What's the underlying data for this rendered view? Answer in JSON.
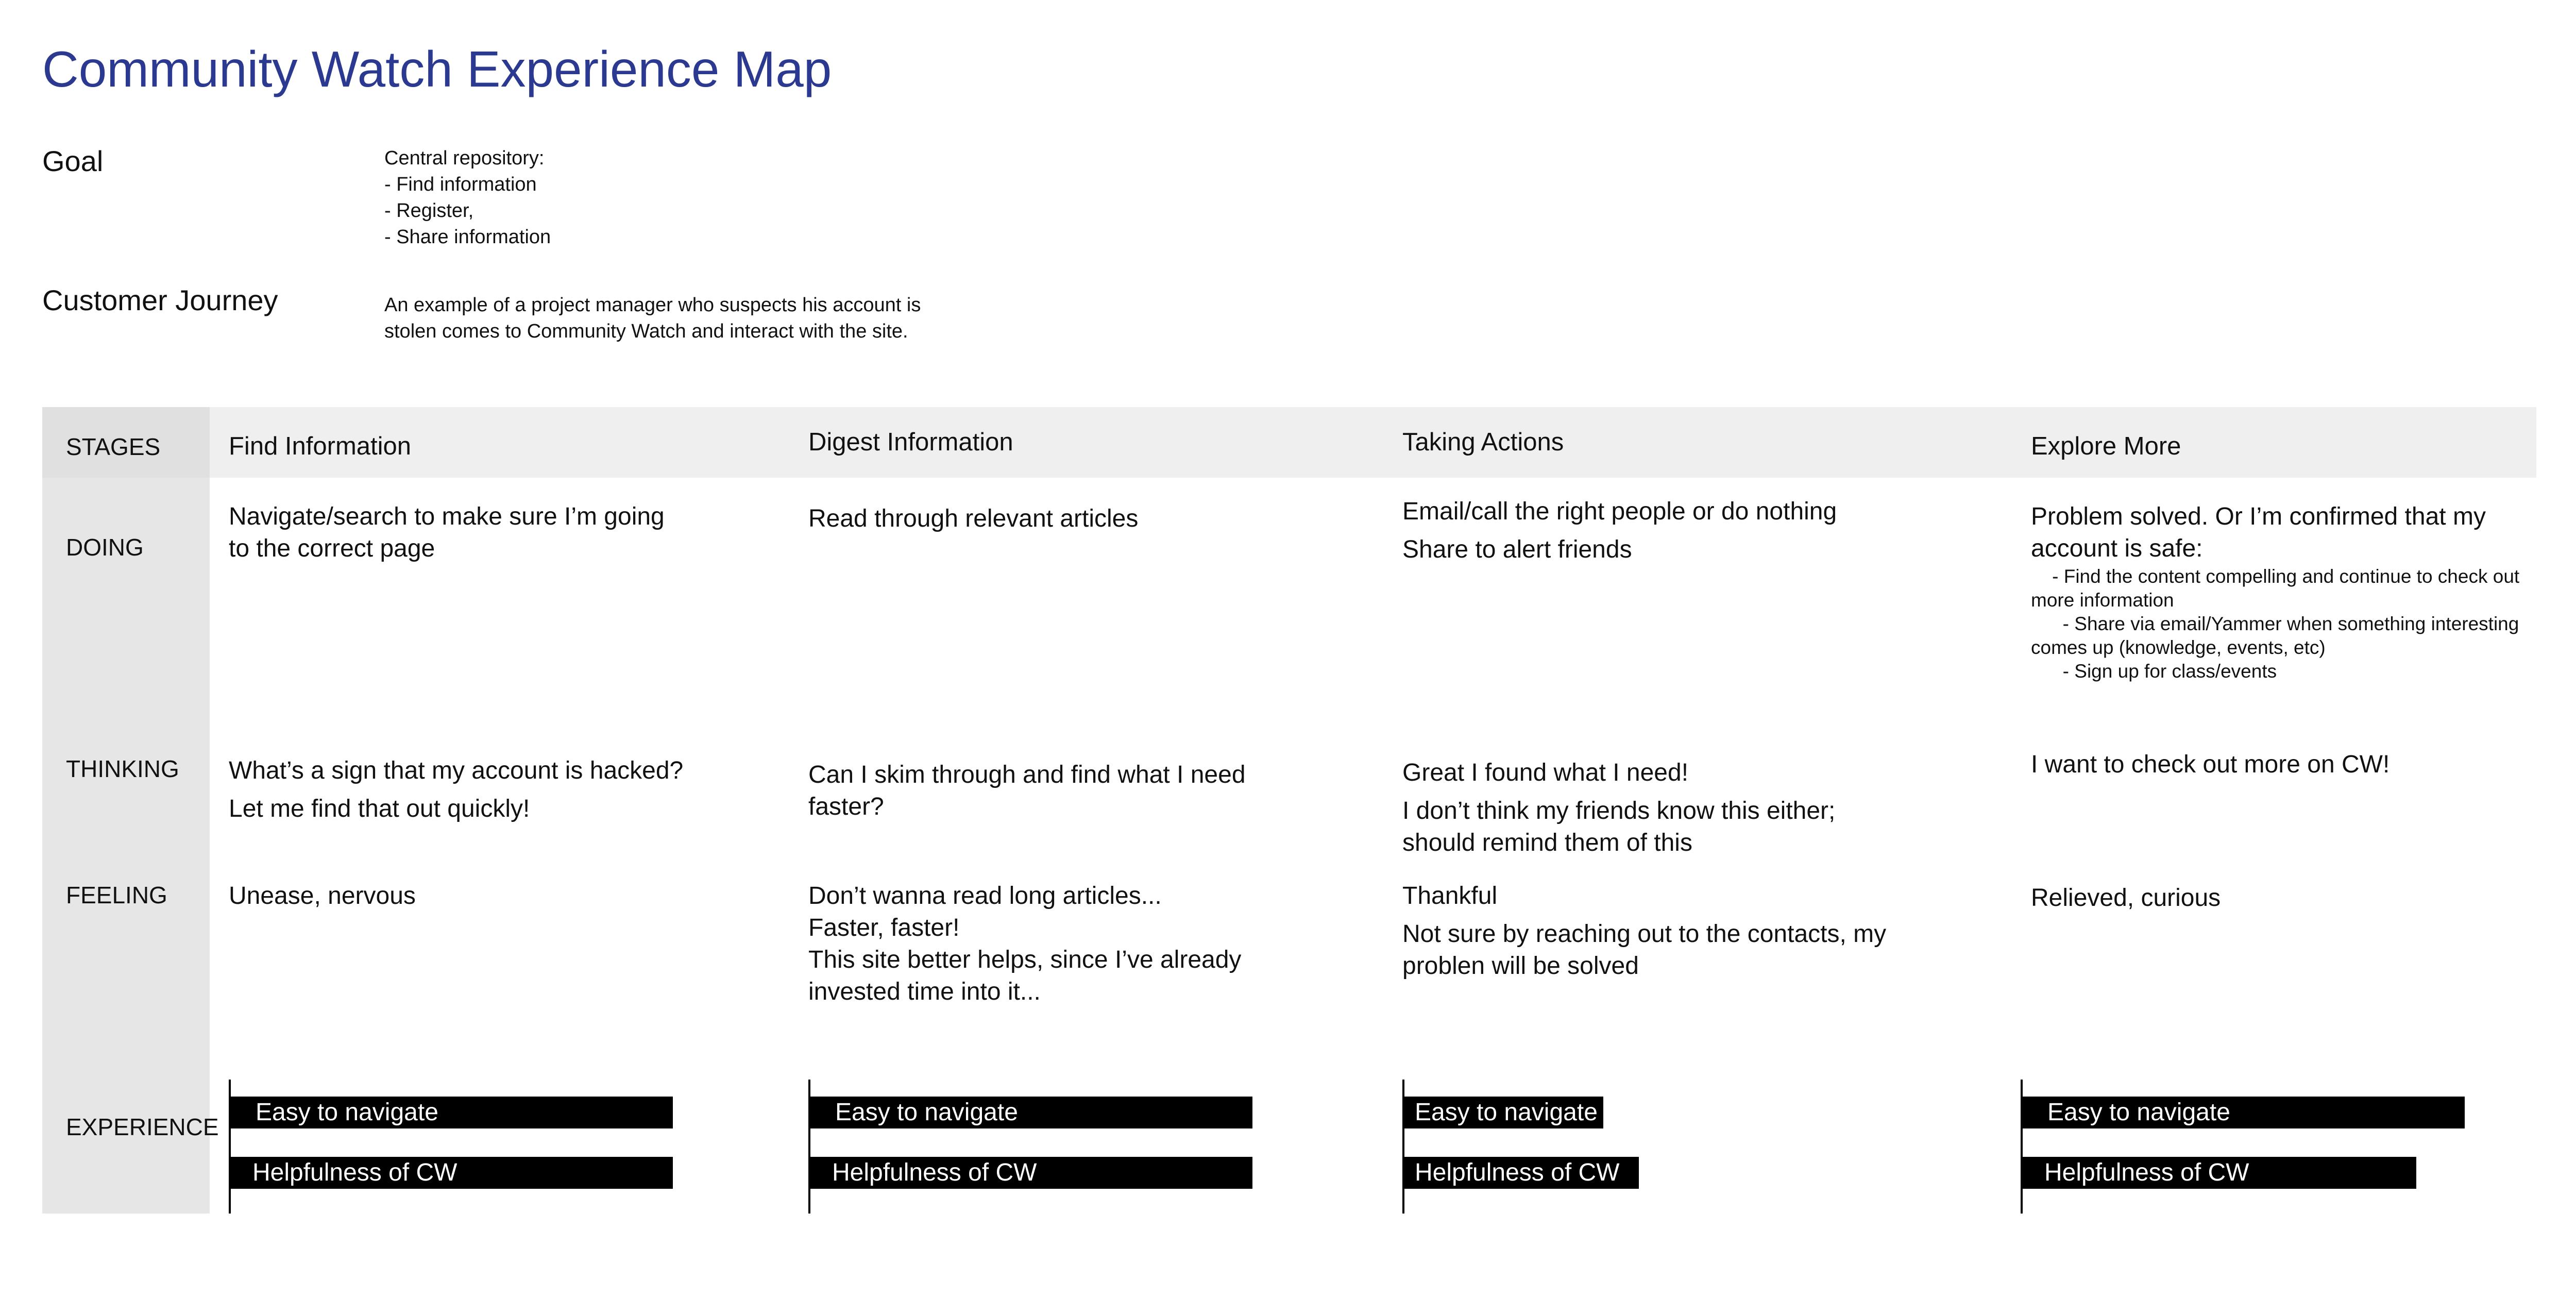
{
  "title": "Community Watch Experience Map",
  "colors": {
    "title": "#2B3990",
    "stage_column": "#E6E6E6",
    "header_row": "#EFEFEF",
    "bar": "#000000"
  },
  "goal": {
    "label": "Goal",
    "lines": [
      "Central repository:",
      "- Find information",
      "- Register,",
      "- Share information"
    ]
  },
  "journey": {
    "label": "Customer Journey",
    "lines": [
      "An example of a project manager who suspects his account is",
      "stolen comes to Community Watch and interact with the site."
    ]
  },
  "rows": {
    "stages": "STAGES",
    "doing": "DOING",
    "thinking": "THINKING",
    "feeling": "FEELING",
    "experience": "EXPERIENCE"
  },
  "stages": [
    {
      "name": "Find Information",
      "doing": {
        "paras": [
          [
            "Navigate/search to make sure I’m going",
            "to the correct page"
          ]
        ]
      },
      "thinking": {
        "paras": [
          [
            "What’s a sign that my account is hacked?"
          ],
          [
            "Let me find that out quickly!"
          ]
        ]
      },
      "feeling": {
        "paras": [
          [
            "Unease, nervous"
          ]
        ]
      },
      "experience": {
        "easy_label": "Easy to navigate",
        "easy_fraction": 1.0,
        "help_label": "Helpfulness of CW",
        "help_fraction": 1.0
      }
    },
    {
      "name": "Digest Information",
      "doing": {
        "paras": [
          [
            "Read through relevant articles"
          ]
        ]
      },
      "thinking": {
        "paras": [
          [
            "Can I skim through and find what I need",
            "faster?"
          ]
        ]
      },
      "feeling": {
        "paras": [
          [
            "Don’t wanna read long articles...",
            "Faster, faster!",
            "This site better helps, since I’ve already",
            "invested time into it..."
          ]
        ]
      },
      "experience": {
        "easy_label": "Easy to navigate",
        "easy_fraction": 1.0,
        "help_label": "Helpfulness of CW",
        "help_fraction": 1.0
      }
    },
    {
      "name": "Taking Actions",
      "doing": {
        "paras": [
          [
            "Email/call the right people or do nothing"
          ],
          [
            "Share to alert friends"
          ]
        ]
      },
      "thinking": {
        "paras": [
          [
            "Great I found what I need!"
          ],
          [
            "I don’t think my friends know this either;",
            "should remind them of this"
          ]
        ]
      },
      "feeling": {
        "paras": [
          [
            "Thankful"
          ],
          [
            "Not sure by reaching out to the contacts, my",
            "problen will be solved"
          ]
        ]
      },
      "experience": {
        "easy_label": "Easy to navigate",
        "easy_fraction": 0.45,
        "help_label": "Helpfulness of CW",
        "help_fraction": 0.53
      }
    },
    {
      "name": "Explore More",
      "doing": {
        "paras": [
          [
            "Problem solved. Or I’m confirmed that my",
            "account is safe:"
          ]
        ],
        "list": [
          "    - Find the content compelling and continue to check out",
          "more information",
          "      - Share via email/Yammer when something interesting",
          "comes up (knowledge, events, etc)",
          "      - Sign up for class/events"
        ]
      },
      "thinking": {
        "paras": [
          [
            "I want to check out more on CW!"
          ]
        ]
      },
      "feeling": {
        "paras": [
          [
            "Relieved, curious"
          ]
        ]
      },
      "experience": {
        "easy_label": "Easy to navigate",
        "easy_fraction": 1.0,
        "help_label": "Helpfulness of CW",
        "help_fraction": 0.89
      }
    }
  ]
}
